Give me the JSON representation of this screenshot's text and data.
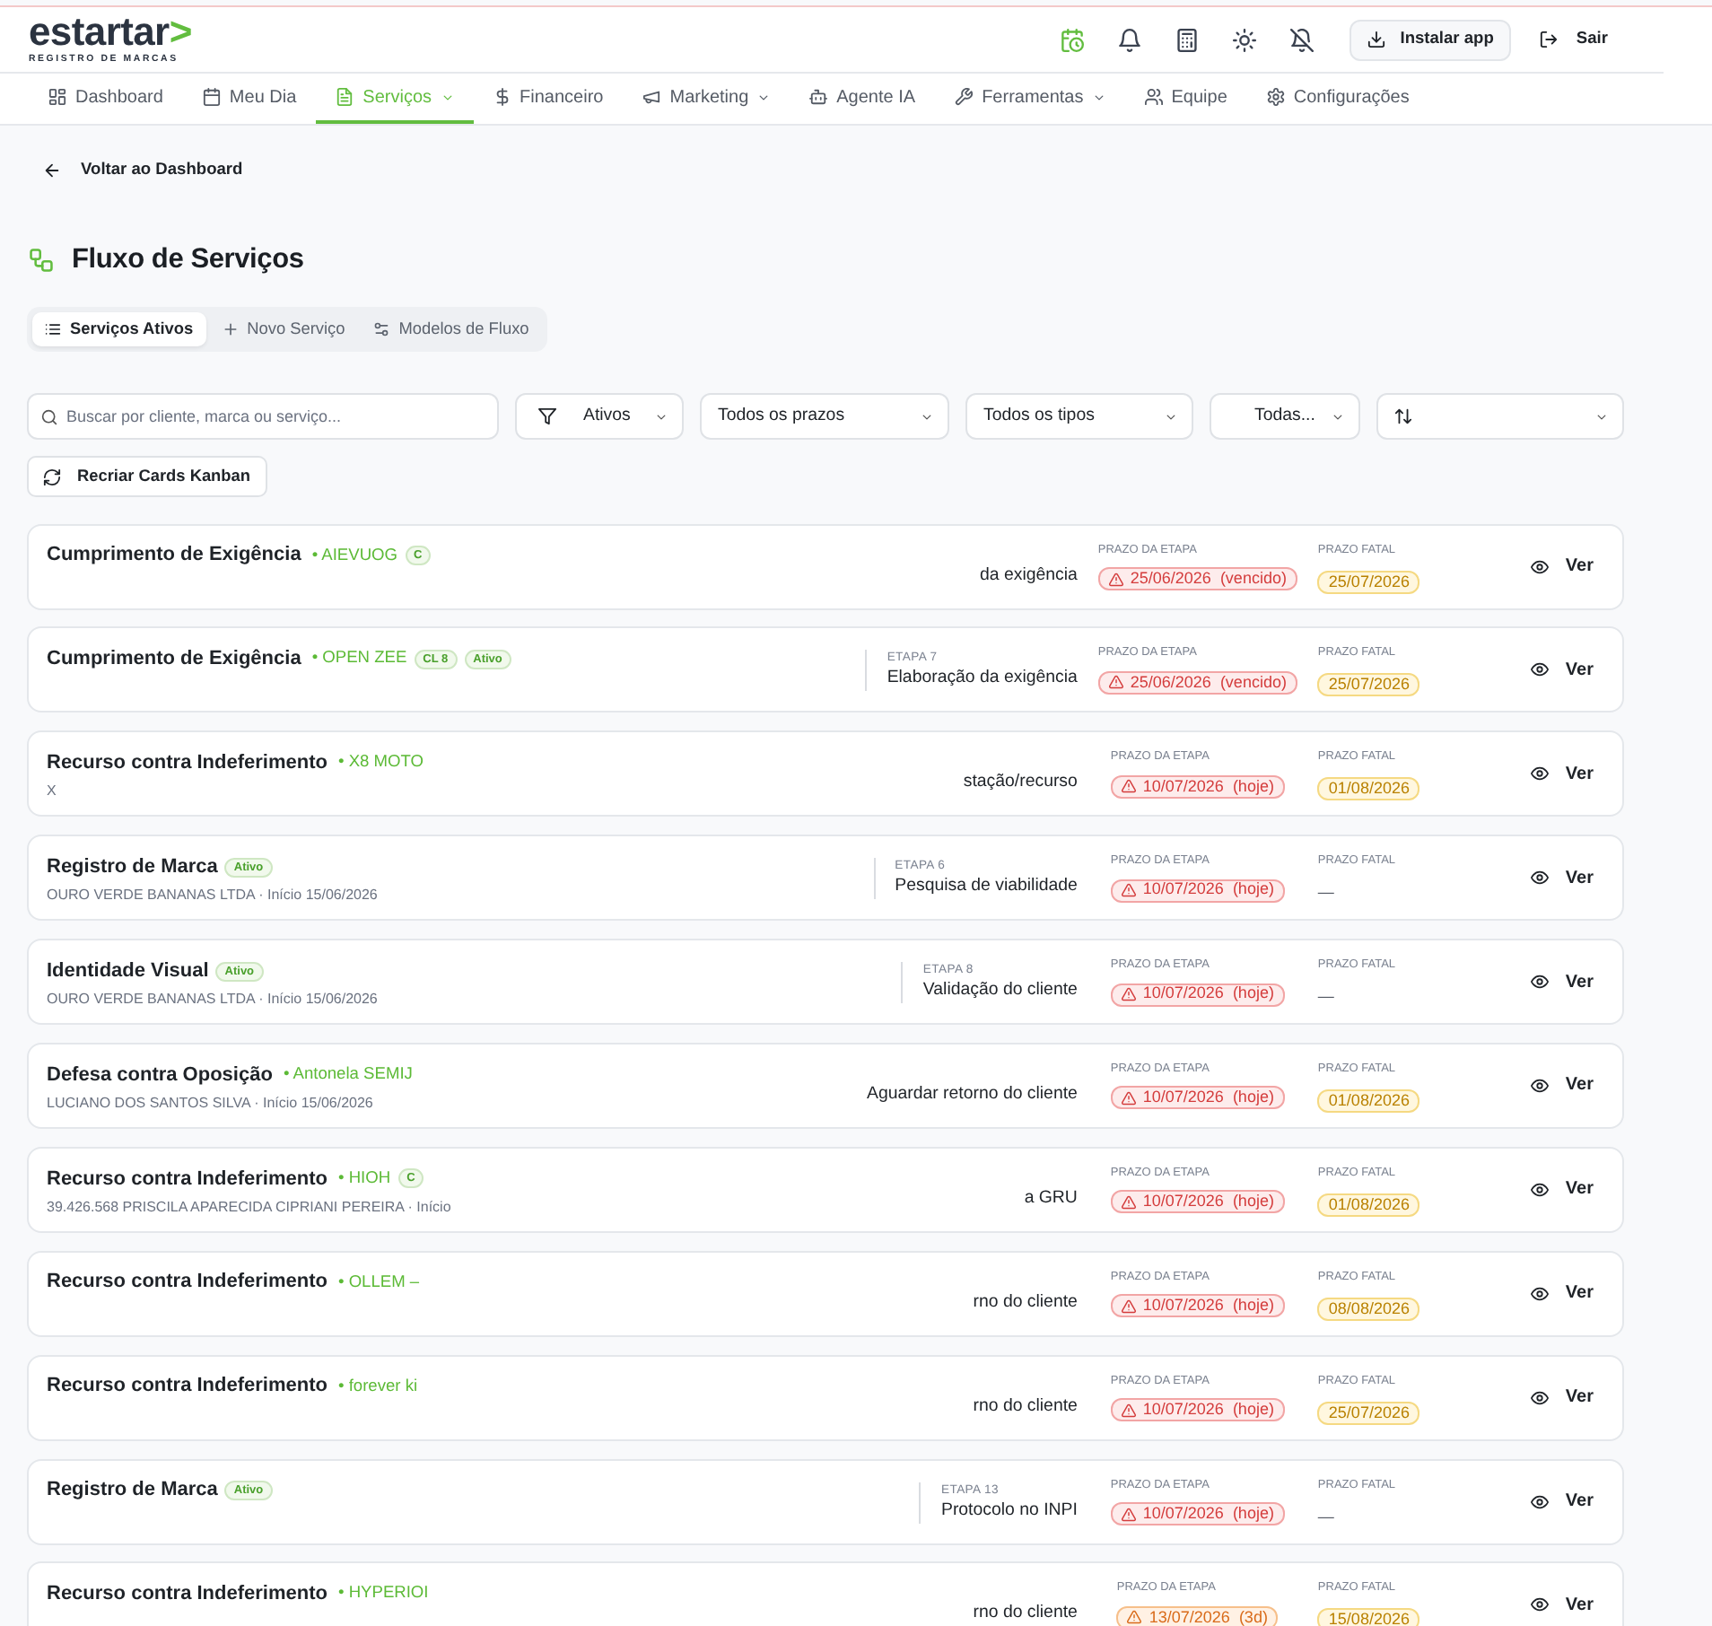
{
  "top_bar": {
    "logo": {
      "word": "estartar",
      "mark": ">",
      "tagline": "REGISTRO DE MARCAS"
    },
    "tools": [
      {
        "kind": "schedule",
        "active": true
      },
      {
        "kind": "notifications",
        "active": false
      },
      {
        "kind": "calculator",
        "active": false
      },
      {
        "kind": "theme",
        "active": false
      },
      {
        "kind": "mute",
        "active": false
      }
    ],
    "install_button": "Instalar app",
    "logout_button": "Sair"
  },
  "nav": [
    {
      "kind": "dashboard",
      "label": "Dashboard",
      "dropdown": false,
      "selected": false
    },
    {
      "kind": "agenda",
      "label": "Meu Dia",
      "dropdown": false,
      "selected": false
    },
    {
      "kind": "services",
      "label": "Serviços",
      "dropdown": true,
      "selected": true
    },
    {
      "kind": "finance",
      "label": "Financeiro",
      "dropdown": false,
      "selected": false
    },
    {
      "kind": "marketing",
      "label": "Marketing",
      "dropdown": true,
      "selected": false
    },
    {
      "kind": "ai-agent",
      "label": "Agente IA",
      "dropdown": false,
      "selected": false
    },
    {
      "kind": "tools",
      "label": "Ferramentas",
      "dropdown": true,
      "selected": false
    },
    {
      "kind": "team",
      "label": "Equipe",
      "dropdown": false,
      "selected": false
    },
    {
      "kind": "settings",
      "label": "Configurações",
      "dropdown": false,
      "selected": false
    }
  ],
  "back_link": "Voltar ao Dashboard",
  "page_title": "Fluxo de Serviços",
  "view_tabs": [
    {
      "kind": "list",
      "label": "Serviços Ativos",
      "selected": true
    },
    {
      "kind": "new",
      "label": "Novo Serviço",
      "selected": false
    },
    {
      "kind": "templates",
      "label": "Modelos de Fluxo",
      "selected": false
    }
  ],
  "filters": {
    "search": {
      "placeholder": "Buscar por cliente, marca ou serviço..."
    },
    "dropdowns": [
      {
        "kind": "status",
        "value": "Ativos"
      },
      {
        "kind": "deadline",
        "value": "Todos os prazos"
      },
      {
        "kind": "type",
        "value": "Todos os tipos"
      },
      {
        "kind": "category",
        "value": "Todas..."
      },
      {
        "kind": "sort"
      }
    ]
  },
  "rebuild_button": "Recriar Cards Kanban",
  "services": [
    {
      "title": "Cumprimento de Exigência",
      "brand": "• AIEVUOG",
      "badges": [
        "C"
      ],
      "stage": "da exigência",
      "deadline_label": "PRAZO DA ETAPA",
      "deadline": {
        "date": "25/06/2026",
        "note": "(vencido)",
        "urgent": true
      },
      "final_label": "PRAZO FATAL",
      "final": {
        "kind": "date",
        "text": "25/07/2026"
      },
      "action": "Ver"
    },
    {
      "title": "Cumprimento de Exigência",
      "brand": "• OPEN ZEE",
      "badges": [
        "CL 8",
        "Ativo"
      ],
      "stage_label": "ETAPA 7",
      "stage": "Elaboração da exigência",
      "deadline_label": "PRAZO DA ETAPA",
      "deadline": {
        "date": "25/06/2026",
        "note": "(vencido)",
        "urgent": true
      },
      "final_label": "PRAZO FATAL",
      "final": {
        "kind": "date",
        "text": "25/07/2026"
      },
      "action": "Ver"
    },
    {
      "title": "Recurso contra Indeferimento",
      "brand": "• X8 MOTO",
      "client": "X",
      "stage": "stação/recurso",
      "deadline_label": "PRAZO DA ETAPA",
      "deadline": {
        "date": "10/07/2026",
        "note": "(hoje)",
        "urgent": true
      },
      "final_label": "PRAZO FATAL",
      "final": {
        "kind": "date",
        "text": "01/08/2026"
      },
      "action": "Ver"
    },
    {
      "title": "Registro de Marca",
      "badges": [
        "Ativo"
      ],
      "client": "OURO VERDE BANANAS LTDA · Início 15/06/2026",
      "stage_label": "ETAPA 6",
      "stage": "Pesquisa de viabilidade",
      "deadline_label": "PRAZO DA ETAPA",
      "deadline": {
        "date": "10/07/2026",
        "note": "(hoje)",
        "urgent": true
      },
      "final_label": "PRAZO FATAL",
      "final": {
        "kind": "none",
        "text": "—"
      },
      "action": "Ver"
    },
    {
      "title": "Identidade Visual",
      "badges": [
        "Ativo"
      ],
      "client": "OURO VERDE BANANAS LTDA · Início 15/06/2026",
      "stage_label": "ETAPA 8",
      "stage": "Validação do cliente",
      "deadline_label": "PRAZO DA ETAPA",
      "deadline": {
        "date": "10/07/2026",
        "note": "(hoje)",
        "urgent": true
      },
      "final_label": "PRAZO FATAL",
      "final": {
        "kind": "none",
        "text": "—"
      },
      "action": "Ver"
    },
    {
      "title": "Defesa contra Oposição",
      "brand": "• Antonela SEMIJ",
      "client": "LUCIANO DOS SANTOS SILVA · Início 15/06/2026",
      "stage": "Aguardar retorno do cliente",
      "deadline_label": "PRAZO DA ETAPA",
      "deadline": {
        "date": "10/07/2026",
        "note": "(hoje)",
        "urgent": true
      },
      "final_label": "PRAZO FATAL",
      "final": {
        "kind": "date",
        "text": "01/08/2026"
      },
      "action": "Ver"
    },
    {
      "title": "Recurso contra Indeferimento",
      "brand": "• HIOH",
      "badges": [
        "C"
      ],
      "client": "39.426.568 PRISCILA APARECIDA CIPRIANI PEREIRA · Início",
      "stage": "a GRU",
      "deadline_label": "PRAZO DA ETAPA",
      "deadline": {
        "date": "10/07/2026",
        "note": "(hoje)",
        "urgent": true
      },
      "final_label": "PRAZO FATAL",
      "final": {
        "kind": "date",
        "text": "01/08/2026"
      },
      "action": "Ver"
    },
    {
      "title": "Recurso contra Indeferimento",
      "brand": "• OLLEM –",
      "stage": "rno do cliente",
      "deadline_label": "PRAZO DA ETAPA",
      "deadline": {
        "date": "10/07/2026",
        "note": "(hoje)",
        "urgent": true
      },
      "final_label": "PRAZO FATAL",
      "final": {
        "kind": "date",
        "text": "08/08/2026"
      },
      "action": "Ver"
    },
    {
      "title": "Recurso contra Indeferimento",
      "brand": "• forever ki",
      "stage": "rno do cliente",
      "deadline_label": "PRAZO DA ETAPA",
      "deadline": {
        "date": "10/07/2026",
        "note": "(hoje)",
        "urgent": true
      },
      "final_label": "PRAZO FATAL",
      "final": {
        "kind": "date",
        "text": "25/07/2026"
      },
      "action": "Ver"
    },
    {
      "title": "Registro de Marca",
      "badges": [
        "Ativo"
      ],
      "stage_label": "ETAPA 13",
      "stage": "Protocolo no INPI",
      "deadline_label": "PRAZO DA ETAPA",
      "deadline": {
        "date": "10/07/2026",
        "note": "(hoje)",
        "urgent": true
      },
      "final_label": "PRAZO FATAL",
      "final": {
        "kind": "none",
        "text": "—"
      },
      "action": "Ver"
    },
    {
      "title": "Recurso contra Indeferimento",
      "brand": "• HYPERIOI",
      "stage": "rno do cliente",
      "deadline_label": "PRAZO DA ETAPA",
      "deadline": {
        "date": "13/07/2026",
        "note": "(3d)",
        "urgent": false
      },
      "final_label": "PRAZO FATAL",
      "final": {
        "kind": "date",
        "text": "15/08/2026"
      },
      "action": "Ver"
    }
  ]
}
